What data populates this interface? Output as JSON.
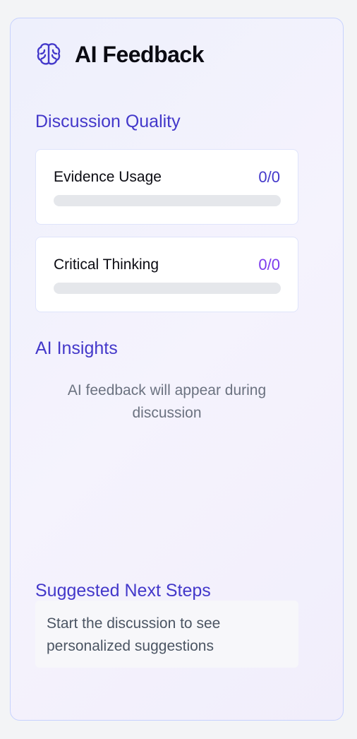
{
  "panel": {
    "title": "AI Feedback",
    "icon": "brain-icon"
  },
  "discussion_quality": {
    "heading": "Discussion Quality",
    "metrics": [
      {
        "label": "Evidence Usage",
        "value": "0/0",
        "value_color": "#4338ca",
        "progress": 0
      },
      {
        "label": "Critical Thinking",
        "value": "0/0",
        "value_color": "#7c3aed",
        "progress": 0
      }
    ]
  },
  "insights": {
    "heading": "AI Insights",
    "empty_text": "AI feedback will appear during discussion"
  },
  "next_steps": {
    "heading": "Suggested Next Steps",
    "empty_text": "Start the discussion to see personalized suggestions"
  },
  "colors": {
    "accent": "#4338ca",
    "accent_purple": "#7c3aed",
    "panel_border": "#c7d2fe"
  }
}
